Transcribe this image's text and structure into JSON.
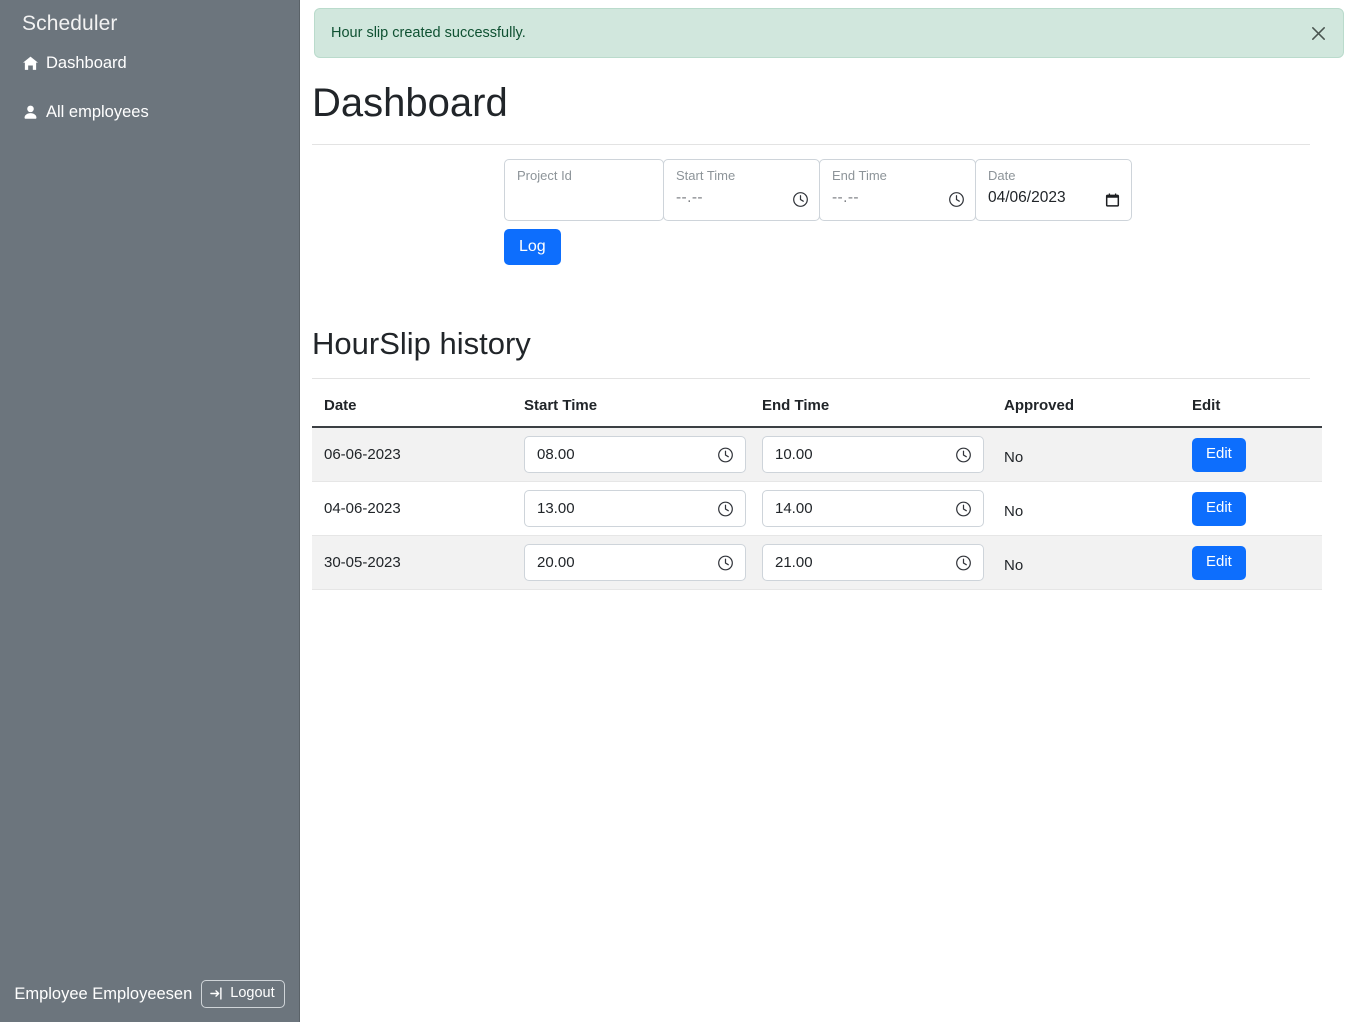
{
  "sidebar": {
    "brand": "Scheduler",
    "items": [
      {
        "label": "Dashboard",
        "icon": "home-icon"
      },
      {
        "label": "All employees",
        "icon": "user-icon"
      }
    ],
    "footer": {
      "user_name": "Employee Employeesen",
      "logout_label": "Logout",
      "logout_icon": "sign-out-icon"
    }
  },
  "alert": {
    "message": "Hour slip created successfully.",
    "close_icon": "close-icon",
    "bg_color": "#d1e7dd",
    "text_color": "#0f5132"
  },
  "page": {
    "title": "Dashboard"
  },
  "log_form": {
    "project": {
      "label": "Project Id",
      "value": "",
      "placeholder": "Project Id"
    },
    "start_time": {
      "label": "Start Time",
      "value": "--.--",
      "icon": "clock-icon"
    },
    "end_time": {
      "label": "End Time",
      "value": "--.--",
      "icon": "clock-icon"
    },
    "date": {
      "label": "Date",
      "value": "04/06/2023",
      "icon": "calendar-icon"
    },
    "submit_label": "Log"
  },
  "history": {
    "title": "HourSlip history",
    "columns": [
      "Date",
      "Start Time",
      "End Time",
      "Approved",
      "Edit"
    ],
    "edit_label": "Edit",
    "clock_icon": "clock-icon",
    "rows": [
      {
        "date": "06-06-2023",
        "start_time": "08.00",
        "end_time": "10.00",
        "approved": "No",
        "edit": "Edit"
      },
      {
        "date": "04-06-2023",
        "start_time": "13.00",
        "end_time": "14.00",
        "approved": "No",
        "edit": "Edit"
      },
      {
        "date": "30-05-2023",
        "start_time": "20.00",
        "end_time": "21.00",
        "approved": "No",
        "edit": "Edit"
      }
    ]
  },
  "colors": {
    "sidebar": "#6c757d",
    "primary": "#0d6efd",
    "success_bg": "#d1e7dd"
  }
}
